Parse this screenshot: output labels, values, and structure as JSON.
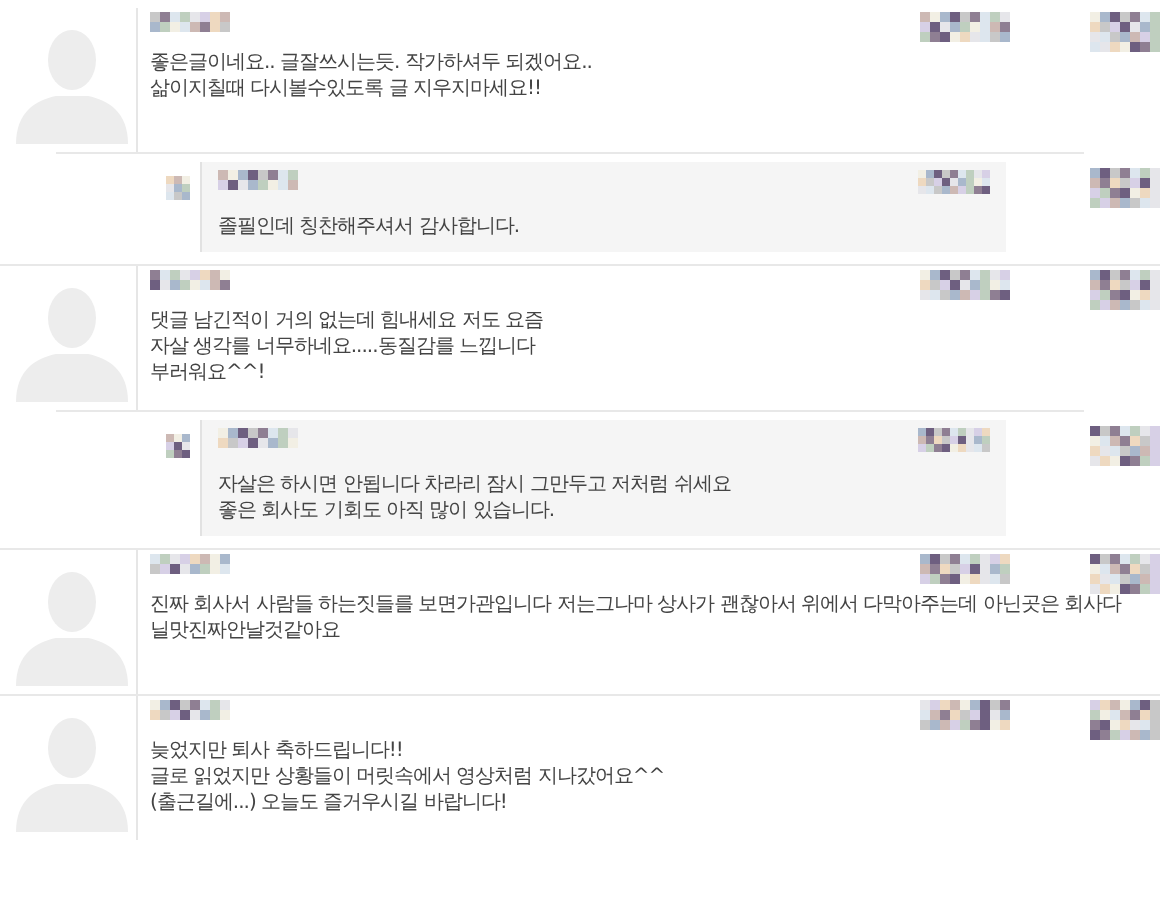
{
  "comments": [
    {
      "kind": "comment",
      "lines": [
        "좋은글이네요.. 글잘쓰시는듯. 작가하셔두 되겠어요..",
        "삶이지칠때 다시볼수있도록 글 지우지마세요!!"
      ]
    },
    {
      "kind": "reply",
      "lines": [
        "졸필인데 칭찬해주셔서 감사합니다."
      ]
    },
    {
      "kind": "comment",
      "lines": [
        "댓글 남긴적이 거의 없는데 힘내세요 저도 요즘",
        "자살 생각를 너무하네요.....동질감를 느낍니다",
        "부러워요^^!"
      ]
    },
    {
      "kind": "reply",
      "lines": [
        "자살은 하시면 안됩니다 차라리 잠시 그만두고 저처럼 쉬세요",
        "좋은 회사도 기회도 아직 많이 있습니다."
      ]
    },
    {
      "kind": "comment",
      "lines": [
        "진짜 회사서 사람들 하는짓들를 보면가관입니다 저는그나마 상사가 괜찮아서 위에서 다막아주는데 아닌곳은 회사다",
        "닐맛진짜안날것같아요"
      ]
    },
    {
      "kind": "comment",
      "lines": [
        "늦었지만 퇴사 축하드립니다!!",
        "글로 읽었지만 상황들이 머릿속에서 영상처럼 지나갔어요^^",
        "(출근길에...) 오늘도 즐거우시길 바랍니다!"
      ]
    }
  ]
}
